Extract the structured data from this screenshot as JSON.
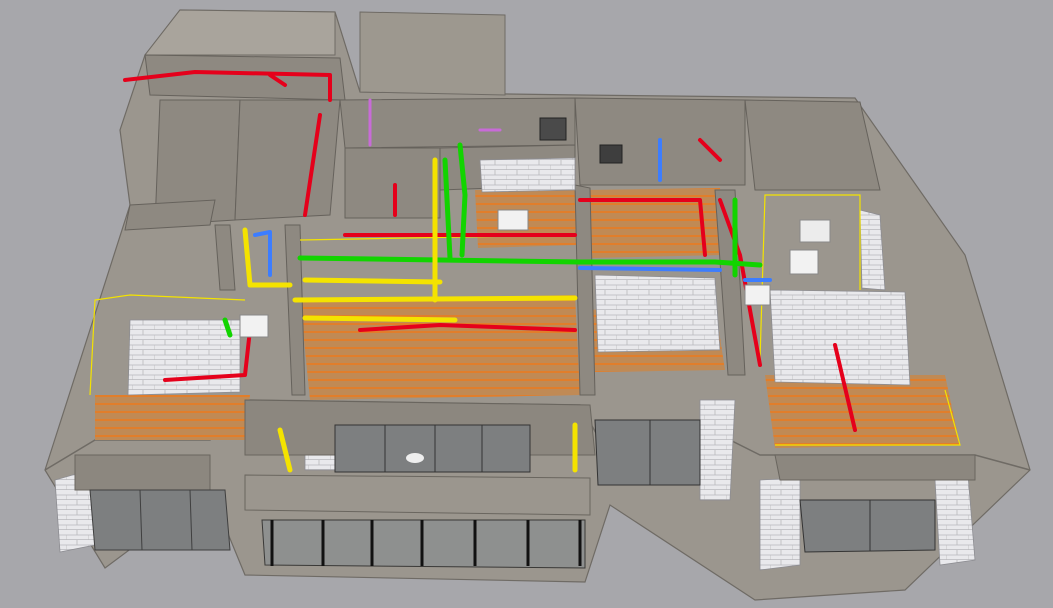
{
  "scene": {
    "kind": "3d-mep-building-model",
    "colors": {
      "background": "#a7a7ab",
      "concrete": "#9b968e",
      "concrete_dark": "#7b766f",
      "floor": "#c08a55",
      "tile": "#e9e9ec",
      "glass": "#7d7f80",
      "red_pipe": "#e5001b",
      "green_pipe": "#12d400",
      "yellow_pipe": "#f4e300",
      "blue_pipe": "#3c7dff",
      "magenta_pipe": "#c86bd8",
      "heating_coil": "#ee7a1a"
    }
  }
}
